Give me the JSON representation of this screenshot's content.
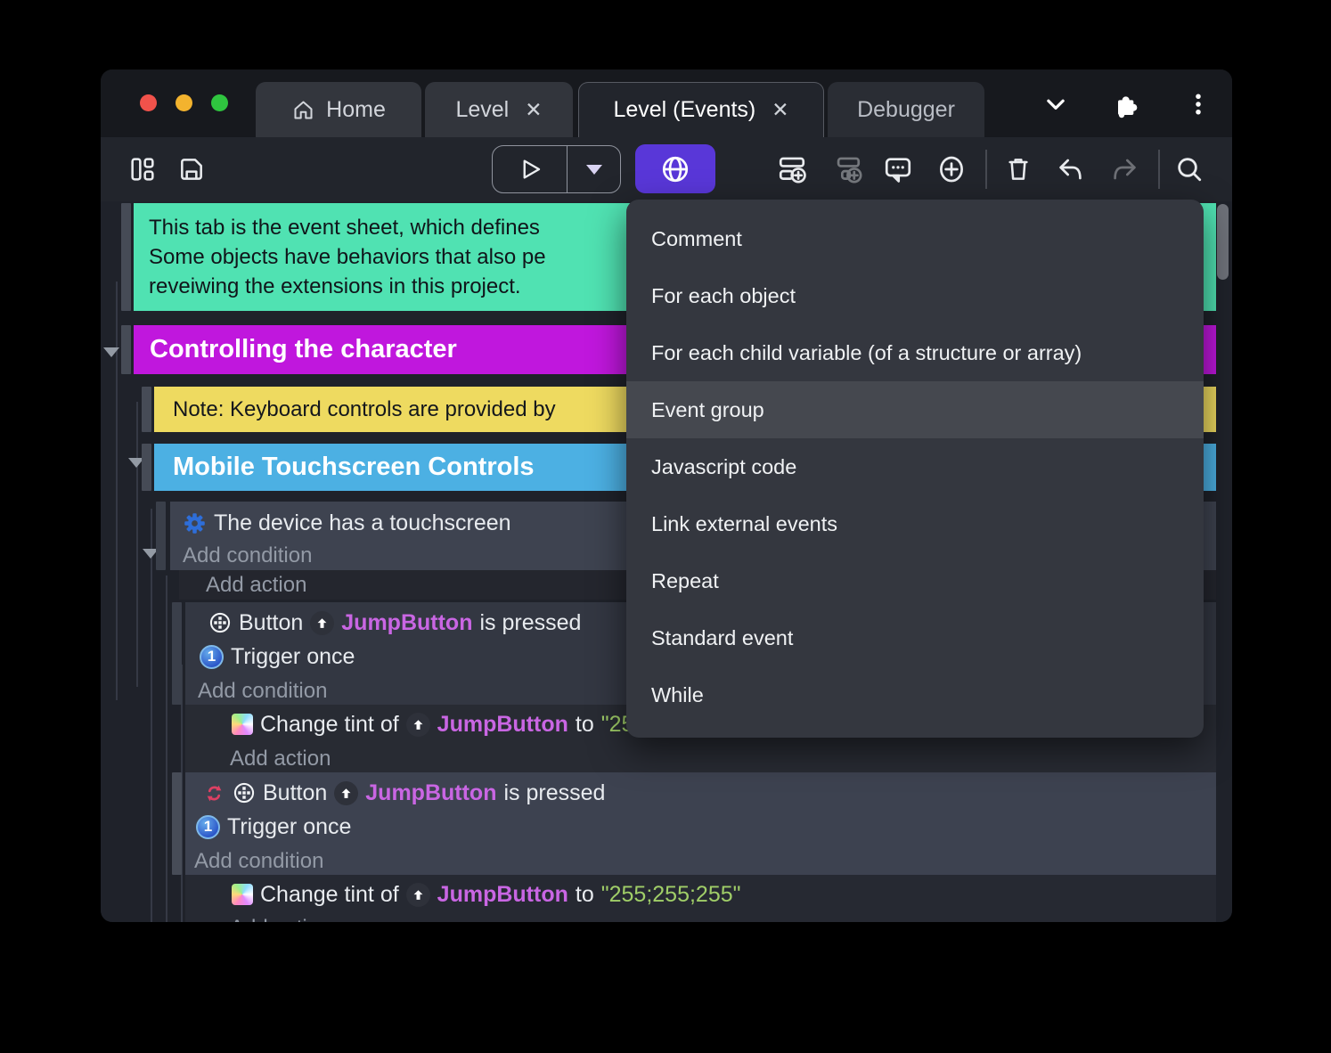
{
  "tabs": {
    "home": "Home",
    "level": "Level",
    "level_events": "Level (Events)",
    "debugger": "Debugger",
    "close_glyph": "✕"
  },
  "toolbar": {
    "icons": [
      "project-manager-icon",
      "save-icon",
      "play-icon",
      "play-options-caret-icon",
      "preview-globe-icon",
      "add-event-icon",
      "add-subevent-icon",
      "add-comment-icon",
      "add-circle-icon",
      "delete-icon",
      "undo-icon",
      "redo-icon",
      "search-icon"
    ],
    "accent_purple": "#5937d8"
  },
  "menu": {
    "items": [
      {
        "label": "Comment"
      },
      {
        "label": "For each object"
      },
      {
        "label": "For each child variable (of a structure or array)"
      },
      {
        "label": "Event group",
        "highlighted": true
      },
      {
        "label": "Javascript code"
      },
      {
        "label": "Link external events"
      },
      {
        "label": "Repeat"
      },
      {
        "label": "Standard event"
      },
      {
        "label": "While"
      }
    ]
  },
  "sheet": {
    "comment_line1": "This tab is the event sheet, which defines",
    "comment_line2": "Some objects have behaviors that also pe",
    "comment_line3": "reveiwing the extensions in this project.",
    "group_controlling": "Controlling the character",
    "note": "Note: Keyboard controls are provided by",
    "group_mobile": "Mobile Touchscreen Controls",
    "condition_touchscreen": "The device has a touchscreen",
    "add_condition": "Add condition",
    "add_action": "Add action",
    "button_word": "Button",
    "object_name": "JumpButton",
    "is_pressed": "is pressed",
    "trigger_once": "Trigger once",
    "change_tint_of": "Change tint of",
    "to_word": "to",
    "tint_value": "\"255;255;255\""
  },
  "colors": {
    "comment_teal": "#50e2b2",
    "group_magenta": "#c017dd",
    "note_yellow": "#eeda60",
    "group_blue": "#4cb0e3",
    "object_magenta": "#c966e3",
    "string_green": "#a0ce68",
    "accent_purple": "#5937d8"
  }
}
